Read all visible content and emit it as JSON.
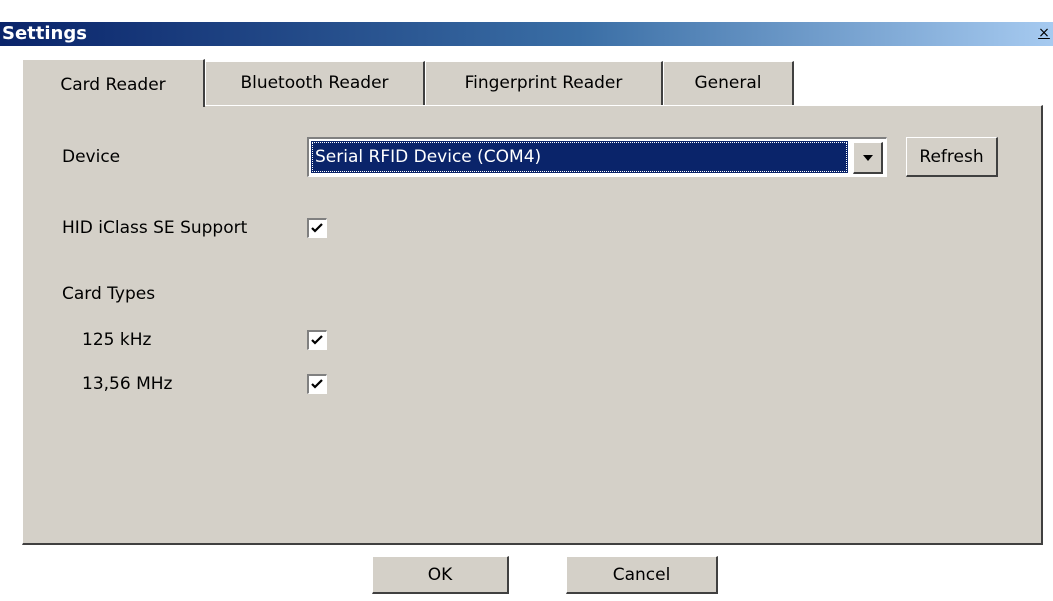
{
  "window": {
    "title": "Settings",
    "close_symbol": "×"
  },
  "tabs": [
    {
      "label": "Card Reader",
      "active": true
    },
    {
      "label": "Bluetooth Reader",
      "active": false
    },
    {
      "label": "Fingerprint Reader",
      "active": false
    },
    {
      "label": "General",
      "active": false
    }
  ],
  "device": {
    "label": "Device",
    "selected_value": "Serial RFID Device (COM4)",
    "dropdown_icon": "chevron-down-icon",
    "refresh_label": "Refresh"
  },
  "hid": {
    "label": "HID iClass SE Support",
    "checked": true
  },
  "card_types": {
    "heading": "Card Types",
    "items": [
      {
        "label": "125 kHz",
        "checked": true
      },
      {
        "label": "13,56 MHz",
        "checked": true
      }
    ]
  },
  "footer": {
    "ok_label": "OK",
    "cancel_label": "Cancel"
  },
  "colors": {
    "title_start": "#0a246a",
    "title_end": "#a6caf0",
    "panel": "#d4d0c8",
    "selection": "#0a246a"
  }
}
